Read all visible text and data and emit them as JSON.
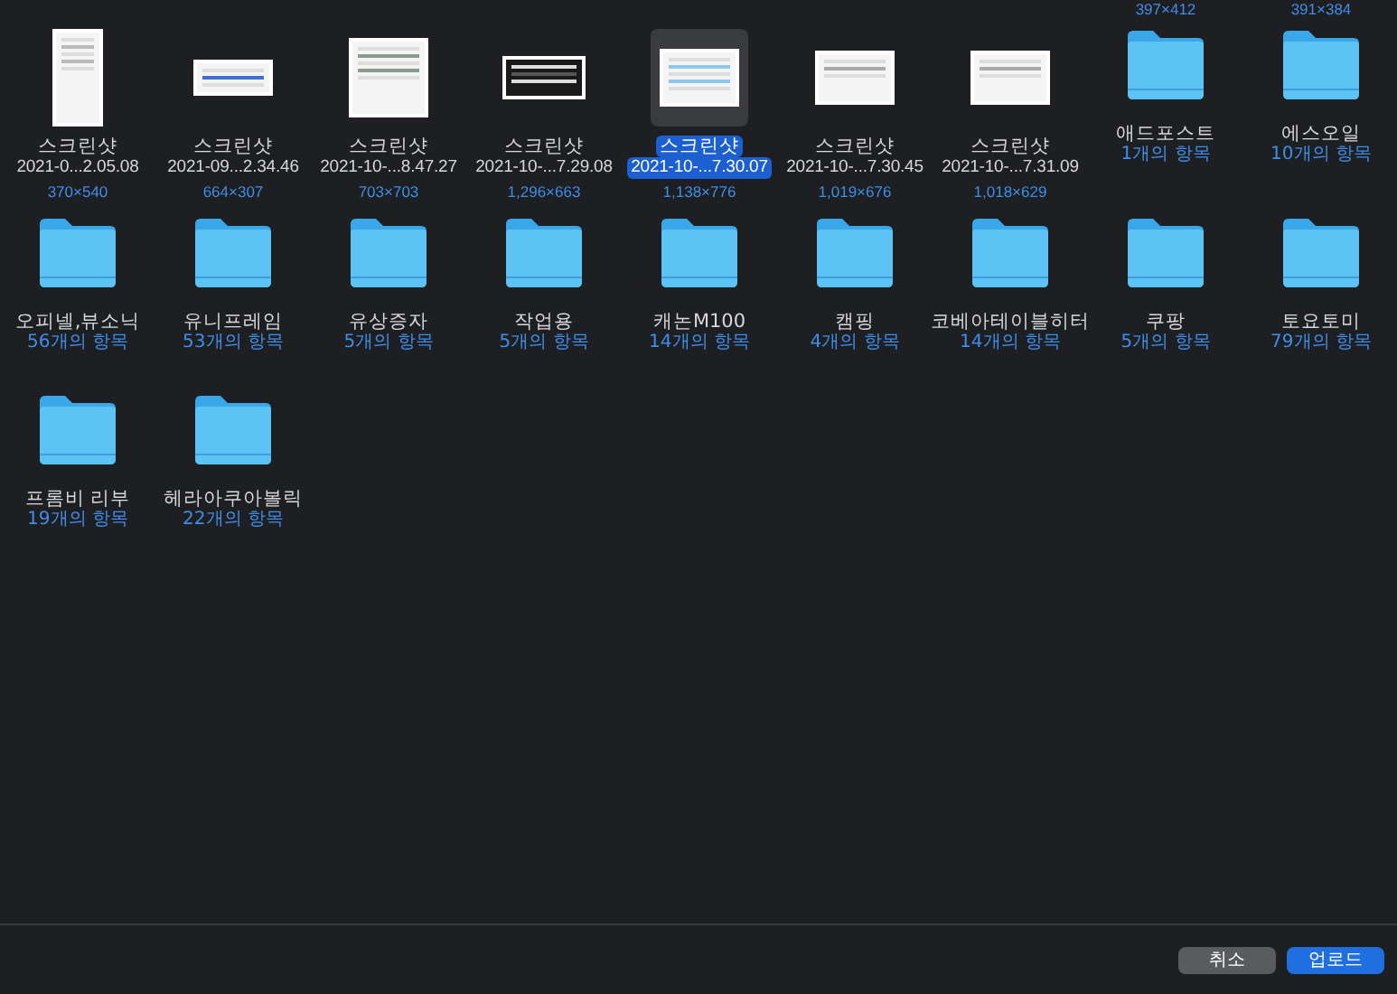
{
  "scrolled_row_dimensions": [
    "397×412",
    "391×384"
  ],
  "items": [
    {
      "kind": "screenshot",
      "name": "스크린샷",
      "subtitle": "2021-0...2.05.08",
      "dimensions": "370×540",
      "selected": false
    },
    {
      "kind": "screenshot",
      "name": "스크린샷",
      "subtitle": "2021-09...2.34.46",
      "dimensions": "664×307",
      "selected": false
    },
    {
      "kind": "screenshot",
      "name": "스크린샷",
      "subtitle": "2021-10-...8.47.27",
      "dimensions": "703×703",
      "selected": false
    },
    {
      "kind": "screenshot",
      "name": "스크린샷",
      "subtitle": "2021-10-...7.29.08",
      "dimensions": "1,296×663",
      "selected": false
    },
    {
      "kind": "screenshot",
      "name": "스크린샷",
      "subtitle": "2021-10-...7.30.07",
      "dimensions": "1,138×776",
      "selected": true
    },
    {
      "kind": "screenshot",
      "name": "스크린샷",
      "subtitle": "2021-10-...7.30.45",
      "dimensions": "1,019×676",
      "selected": false
    },
    {
      "kind": "screenshot",
      "name": "스크린샷",
      "subtitle": "2021-10-...7.31.09",
      "dimensions": "1,018×629",
      "selected": false
    },
    {
      "kind": "folder",
      "name": "애드포스트",
      "count": "1개의 항목",
      "selected": false
    },
    {
      "kind": "folder",
      "name": "에스오일",
      "count": "10개의 항목",
      "selected": false
    },
    {
      "kind": "folder",
      "name": "오피넬,뷰소닉",
      "count": "56개의 항목",
      "selected": false
    },
    {
      "kind": "folder",
      "name": "유니프레임",
      "count": "53개의 항목",
      "selected": false
    },
    {
      "kind": "folder",
      "name": "유상증자",
      "count": "5개의 항목",
      "selected": false
    },
    {
      "kind": "folder",
      "name": "작업용",
      "count": "5개의 항목",
      "selected": false
    },
    {
      "kind": "folder",
      "name": "캐논M100",
      "count": "14개의 항목",
      "selected": false
    },
    {
      "kind": "folder",
      "name": "캠핑",
      "count": "4개의 항목",
      "selected": false
    },
    {
      "kind": "folder",
      "name": "코베아테이블히터",
      "count": "14개의 항목",
      "selected": false
    },
    {
      "kind": "folder",
      "name": "쿠팡",
      "count": "5개의 항목",
      "selected": false
    },
    {
      "kind": "folder",
      "name": "토요토미",
      "count": "79개의 항목",
      "selected": false
    },
    {
      "kind": "folder",
      "name": "프롬비 리부",
      "count": "19개의 항목",
      "selected": false
    },
    {
      "kind": "folder",
      "name": "헤라아쿠아볼릭",
      "count": "22개의 항목",
      "selected": false
    }
  ],
  "buttons": [
    {
      "label": "취소",
      "kind": "secondary"
    },
    {
      "label": "업로드",
      "kind": "primary"
    }
  ]
}
